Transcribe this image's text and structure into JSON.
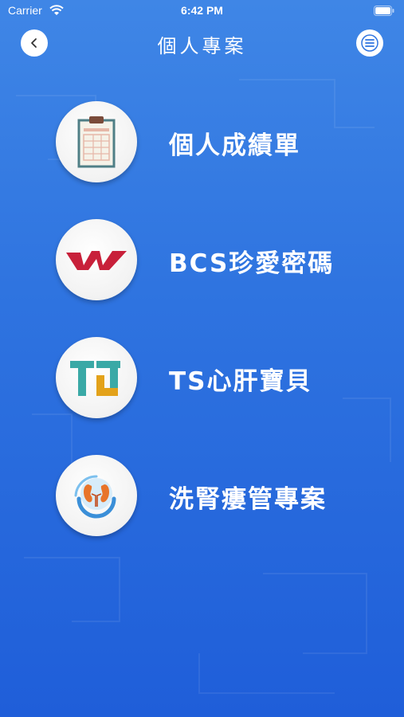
{
  "status_bar": {
    "carrier": "Carrier",
    "time": "6:42 PM"
  },
  "header": {
    "title": "個人專案",
    "back_icon": "chevron-left-icon",
    "menu_icon": "hamburger-menu-icon"
  },
  "items": [
    {
      "label": "個人成績單",
      "icon": "clipboard-icon"
    },
    {
      "label": "BCS珍愛密碼",
      "icon": "bcs-logo-icon"
    },
    {
      "label": "TS心肝寶貝",
      "icon": "ts-logo-icon"
    },
    {
      "label": "洗腎瘻管專案",
      "icon": "kidney-icon"
    }
  ],
  "colors": {
    "background_top": "#3f86e6",
    "background_bottom": "#1f5ed9",
    "bcs_red": "#c8203a",
    "ts_teal": "#3aa9a6",
    "ts_gold": "#e3a21a"
  }
}
